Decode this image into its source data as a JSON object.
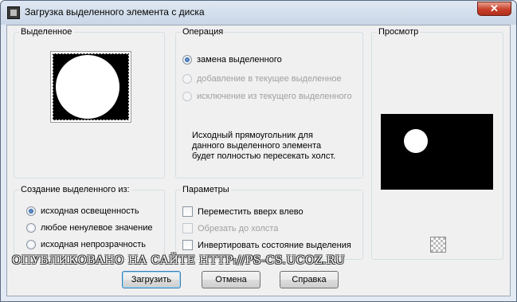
{
  "window": {
    "title": "Загрузка выделенного элемента с диска",
    "close_symbol": "✕"
  },
  "selection_group": {
    "label": "Выделенное"
  },
  "operation_group": {
    "label": "Операция",
    "options": [
      {
        "label": "замена выделенного",
        "selected": true,
        "enabled": true
      },
      {
        "label": "добавление в текущее выделенное",
        "selected": false,
        "enabled": false
      },
      {
        "label": "исключение из текущего выделенного",
        "selected": false,
        "enabled": false
      }
    ],
    "description": [
      "Исходный прямоугольник для",
      "данного выделенного элемента",
      "будет полностью пересекать холст."
    ]
  },
  "preview_group": {
    "label": "Просмотр",
    "transparency_icon": "checkerboard-icon"
  },
  "create_from_group": {
    "label": "Создание выделенного из:",
    "options": [
      {
        "label": "исходная освещенность",
        "selected": true
      },
      {
        "label": "любое ненулевое значение",
        "selected": false
      },
      {
        "label": "исходная непрозрачность",
        "selected": false
      }
    ]
  },
  "params_group": {
    "label": "Параметры",
    "options": [
      {
        "label": "Переместить вверх влево",
        "checked": false,
        "enabled": true
      },
      {
        "label": "Обрезать до холста",
        "checked": false,
        "enabled": false
      },
      {
        "label": "Инвертировать состояние выделения",
        "checked": false,
        "enabled": true
      }
    ]
  },
  "buttons": {
    "load": "Загрузить",
    "cancel": "Отмена",
    "help": "Справка"
  },
  "watermark": "ОПУБЛИКОВАНО   НА САЙТЕ   HTTP://PS-CS.UCOZ.RU",
  "colors": {
    "accent": "#1e4f8f",
    "close_red": "#c8402a"
  }
}
